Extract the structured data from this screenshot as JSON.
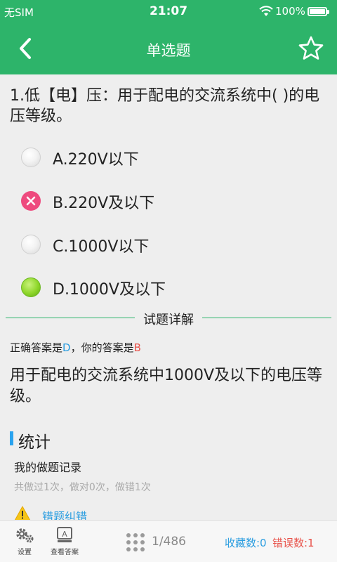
{
  "status_bar": {
    "carrier": "无SIM",
    "time": "21:07",
    "battery": "100%"
  },
  "header": {
    "title": "单选题",
    "back_icon": "back-chevron-icon",
    "favorite_icon": "star-outline-icon"
  },
  "question": {
    "text": "1.低【电】压：用于配电的交流系统中( )的电压等级。",
    "options": [
      {
        "label": "A.220V以下",
        "state": "unselected"
      },
      {
        "label": "B.220V及以下",
        "state": "wrong"
      },
      {
        "label": "C.1000V以下",
        "state": "unselected"
      },
      {
        "label": "D.1000V及以下",
        "state": "correct"
      }
    ]
  },
  "explanation": {
    "section_title": "试题详解",
    "answer_prefix": "正确答案是",
    "correct_answer": "D",
    "your_prefix": "，你的答案是",
    "your_answer": "B",
    "text": "用于配电的交流系统中1000V及以下的电压等级。"
  },
  "stats": {
    "title": "统计",
    "record_title": "我的做题记录",
    "record_detail": "共做过1次，做对0次，做错1次"
  },
  "report": {
    "label": "错题纠错"
  },
  "bottom_bar": {
    "settings_label": "设置",
    "view_answer_label": "查看答案",
    "progress": "1/486",
    "favorites": "收藏数:0",
    "errors": "错误数:1"
  },
  "colors": {
    "primary_green": "#2db46a",
    "accent_blue": "#2a9de0",
    "error_red": "#e8524a",
    "wrong_pink": "#ee4a7e",
    "correct_green": "#8ed62a"
  }
}
